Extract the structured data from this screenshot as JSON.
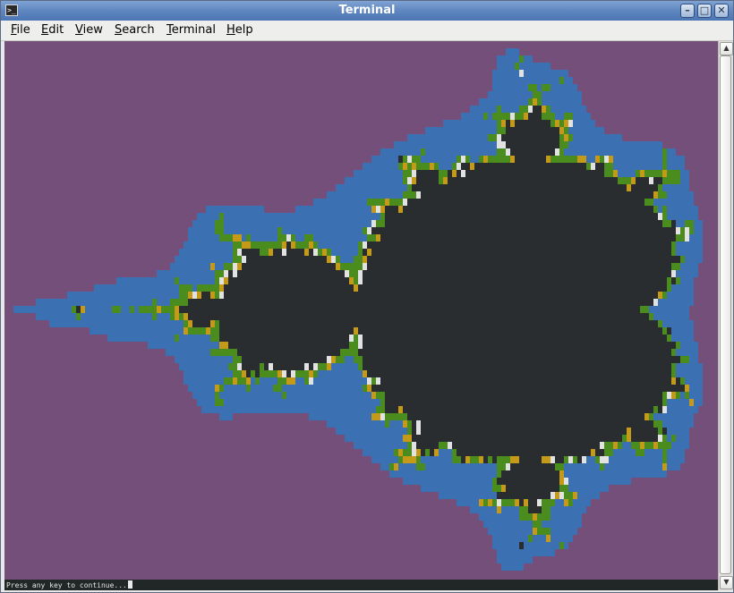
{
  "window": {
    "title": "Terminal",
    "app_icon_glyph": ">_",
    "controls": {
      "minimize": "–",
      "maximize": "□",
      "close": "✕"
    }
  },
  "menu": [
    {
      "label": "File",
      "mnemonic": "F",
      "rest": "ile"
    },
    {
      "label": "Edit",
      "mnemonic": "E",
      "rest": "dit"
    },
    {
      "label": "View",
      "mnemonic": "V",
      "rest": "iew"
    },
    {
      "label": "Search",
      "mnemonic": "S",
      "rest": "earch"
    },
    {
      "label": "Terminal",
      "mnemonic": "T",
      "rest": "erminal"
    },
    {
      "label": "Help",
      "mnemonic": "H",
      "rest": "elp"
    }
  ],
  "terminal": {
    "status_text": "Press any key to continue...",
    "colors": {
      "background": "#734f7a",
      "set": "#2a2d2f",
      "band_blue": "#3b70b3",
      "band_green": "#4b8c1e",
      "band_yellow": "#c49a18",
      "band_white": "#e2e2e2"
    }
  },
  "scrollbar": {
    "up_icon": "▲",
    "down_icon": "▼"
  }
}
